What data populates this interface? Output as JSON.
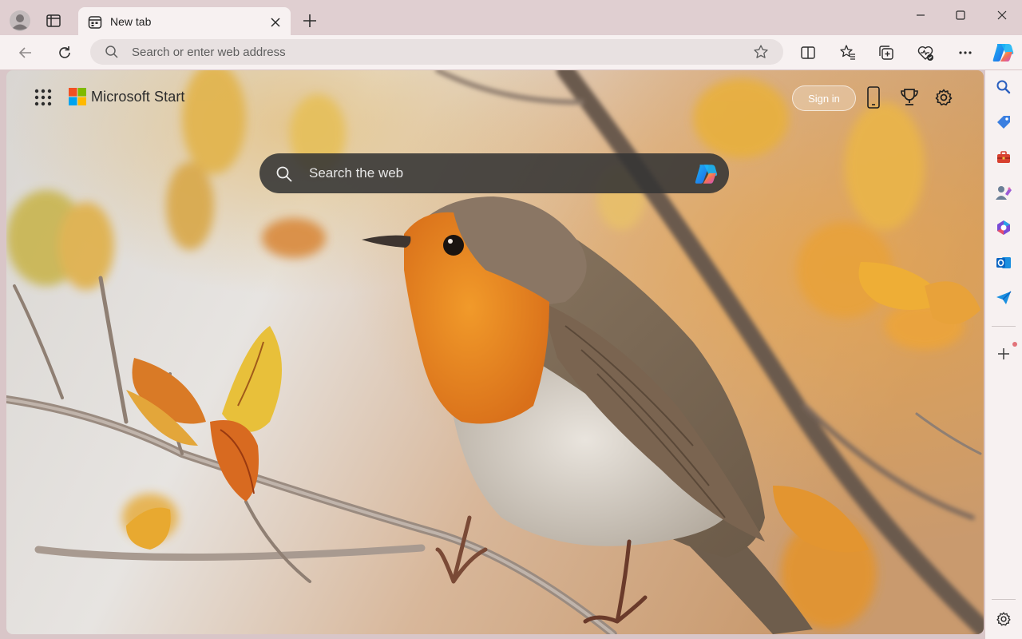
{
  "window": {
    "tab": {
      "title": "New tab"
    }
  },
  "toolbar": {
    "address_placeholder": "Search or enter web address"
  },
  "page": {
    "brand": "Microsoft Start",
    "sign_in_label": "Sign in",
    "search_placeholder": "Search the web"
  },
  "colors": {
    "titlebar_bg": "#e0cfd1",
    "toolbar_bg": "#f7f1f1",
    "address_bg": "#e8e1e1",
    "search_box_bg": "#343434",
    "ms_red": "#f25022",
    "ms_green": "#7fba00",
    "ms_blue": "#00a4ef",
    "ms_yellow": "#ffb900"
  },
  "icons": {
    "titlebar": [
      "profile-icon",
      "tab-actions-icon",
      "tab-favicon-icon",
      "close-tab-icon",
      "new-tab-icon",
      "minimize-icon",
      "maximize-icon",
      "close-window-icon"
    ],
    "toolbar": [
      "back-icon",
      "refresh-icon",
      "search-icon",
      "favorite-star-icon",
      "split-screen-icon",
      "favorites-icon",
      "collections-icon",
      "browser-essentials-icon",
      "more-icon",
      "copilot-icon"
    ],
    "page": [
      "apps-launcher-icon",
      "microsoft-logo",
      "phone-icon",
      "rewards-trophy-icon",
      "settings-gear-icon",
      "search-icon",
      "copilot-icon"
    ],
    "sidebar": [
      "search-icon",
      "shopping-tag-icon",
      "tools-briefcase-icon",
      "games-icon",
      "microsoft-365-icon",
      "outlook-icon",
      "drop-send-icon",
      "add-icon",
      "settings-gear-icon"
    ]
  }
}
